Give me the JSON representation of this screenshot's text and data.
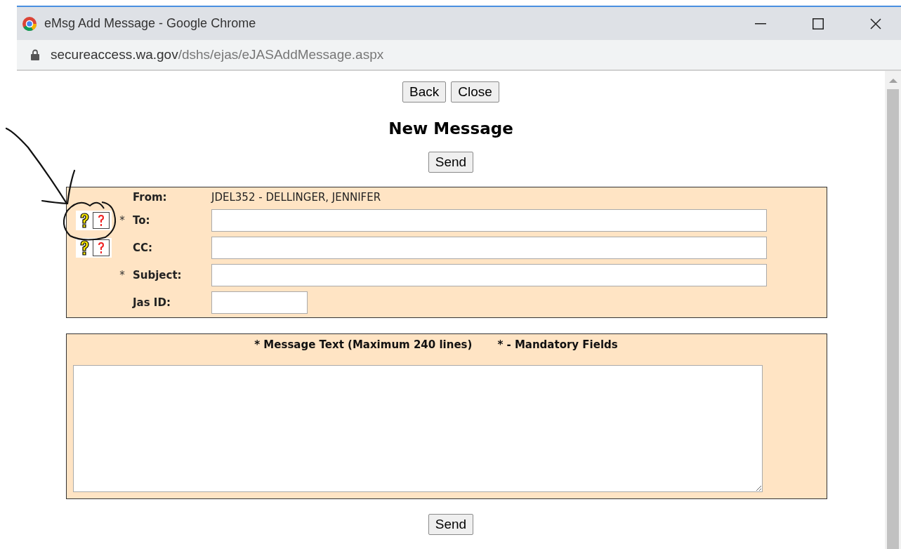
{
  "window": {
    "title": "eMsg Add Message - Google Chrome"
  },
  "address": {
    "host": "secureaccess.wa.gov",
    "path": "/dshs/ejas/eJASAddMessage.aspx"
  },
  "top_buttons": [
    "Back",
    "Close"
  ],
  "heading": "New Message",
  "send_top": "Send",
  "fields": [
    {
      "kind": "text",
      "label": "From:",
      "value": "JDEL352 - DELLINGER, JENNIFER",
      "required": false,
      "help": false
    },
    {
      "kind": "input",
      "label": "To:",
      "required": true,
      "help": true
    },
    {
      "kind": "input",
      "label": "CC:",
      "required": false,
      "help": true
    },
    {
      "kind": "input",
      "label": "Subject:",
      "required": true,
      "help": false
    },
    {
      "kind": "short_input",
      "label": "Jas ID:",
      "required": false,
      "help": false
    }
  ],
  "required_mark": "*",
  "message": {
    "label": "* Message Text (Maximum 240 lines)",
    "legend": "* - Mandatory Fields"
  },
  "send_bottom": "Send"
}
